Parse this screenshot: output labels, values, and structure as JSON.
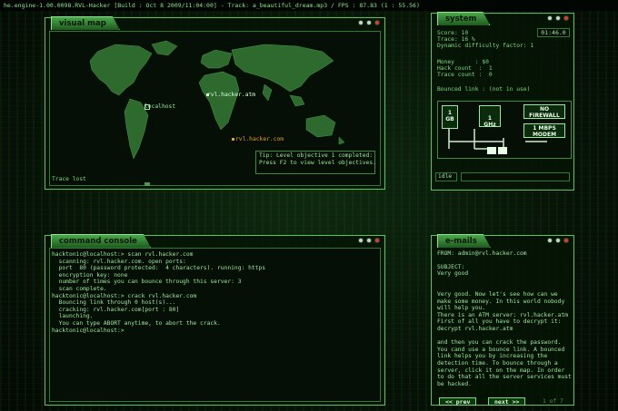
{
  "topbar": {
    "text": "he.engine-1.00.0098.RVL-Hacker [Build : Oct  8 2009/11:04:00] - Track: a_beautiful_dream.mp3 / FPS : 87.83 (1 : 55.56)"
  },
  "map": {
    "title": "visual map",
    "nodes": [
      {
        "label": "rvl.hacker.atm",
        "color": "#d8ffd8"
      },
      {
        "label": "localhost",
        "color": "#9fe89f"
      },
      {
        "label": "rvl.hacker.com",
        "color": "#e8a020"
      }
    ],
    "status": "Trace lost",
    "tip": "Tip: Level objective 1 completed:\nPress F2 to view level objectives."
  },
  "system": {
    "title": "system",
    "clock": "01:46.0",
    "score": "Score: 10",
    "trace": "Trace: 16 %",
    "difficulty": "Dynamic difficulty factor: 1",
    "money": "Money      : $0",
    "hack_count": "Hack count  :  1",
    "trace_count": "Trace count :  0",
    "bounced": "Bounced link : (not in use)",
    "memory": "1\nGB",
    "cpu": "1\nGHz",
    "firewall": "NO\nFIREWALL",
    "modem": "1 MBPS\nMODEM",
    "idle": "idle"
  },
  "console": {
    "title": "command console",
    "lines": "hacktonic@localhost:> scan rvl.hacker.com\n  scanning: rvl.hacker.com. open ports:\n  port  80 (password protected:  4 characters). running: https\n  encryption key: none\n  number of times you can bounce through this server: 3\n  scan complete.\nhacktonic@localhost:> crack rvl.hacker.com\n  Bouncing link through 0 host(s)...\n  cracking: rvl.hacker.com[port : 80]\n  launching.\n  You can type ABORT anytime, to abort the crack.\nhacktonic@localhost:>"
  },
  "emails": {
    "title": "e-mails",
    "from": "FROM: admin@rvl.hacker.com",
    "subject_label": "SUBJECT:",
    "subject": "Very good",
    "body": "Very good. Now let's see how can we\nmake some money. In this world nobody\nwill help you.\nThere is an ATM server: rvl.hacker.atm\nFirst of all you have to decrypt it:\ndecrypt rvl.hacker.atm\n\nand then you can crack the password.\nYou cand use a bounce link. A bounced\nlink helps you by increasing the\ndetection time. To bounce through a\nserver, click it on the map. In order\nto do that all the server services must\nbe hacked.",
    "prev": "<< prev",
    "next": "next >>",
    "page": "1 of 7"
  }
}
